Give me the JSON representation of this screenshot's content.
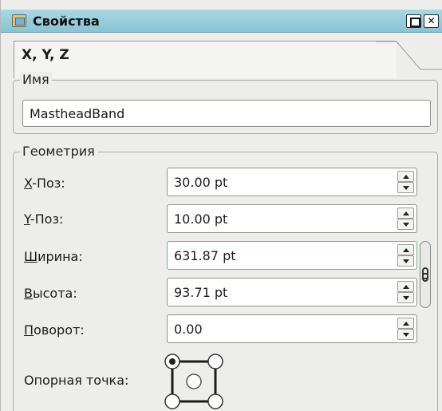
{
  "window": {
    "title": "Свойства",
    "close_glyph": "✕",
    "icons": {
      "app": "properties-app-icon",
      "maximize": "maximize-icon",
      "close": "close-icon"
    }
  },
  "tabs": {
    "active": "X, Y, Z"
  },
  "name_group": {
    "legend": "Имя",
    "value": "MastheadBand"
  },
  "geometry": {
    "legend": "Геометрия",
    "x": {
      "mnemonic": "X",
      "rest": "-Поз:",
      "value": "30.00 pt"
    },
    "y": {
      "mnemonic": "Y",
      "rest": "-Поз:",
      "value": "10.00 pt"
    },
    "width": {
      "mnemonic": "Ш",
      "rest": "ирина:",
      "value": "631.87 pt"
    },
    "height": {
      "mnemonic": "В",
      "rest": "ысота:",
      "value": "93.71 pt"
    },
    "rotation": {
      "mnemonic": "П",
      "rest": "оворот:",
      "value": "0.00"
    },
    "anchor_label": "Опорная точка:",
    "anchor_selected": "top-left"
  }
}
